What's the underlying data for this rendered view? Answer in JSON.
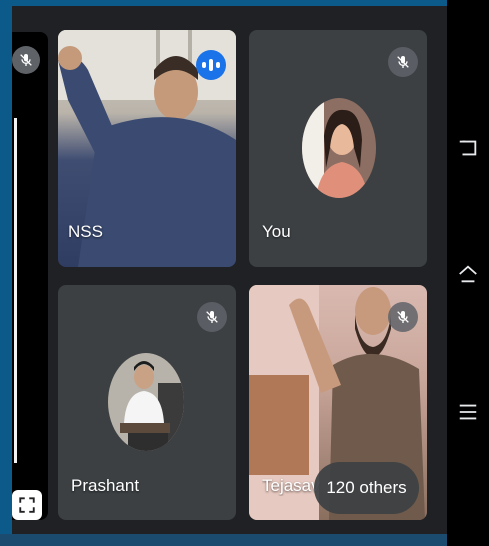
{
  "participants": [
    {
      "name": "NSS",
      "mic": "speaking"
    },
    {
      "name": "You",
      "mic": "muted"
    },
    {
      "name": "Prashant",
      "mic": "muted"
    },
    {
      "name": "Tejasav",
      "mic": "muted"
    }
  ],
  "others": {
    "label": "120 others"
  },
  "icons": {
    "mic_off": "mic-off-icon",
    "speaking": "speaking-indicator-icon",
    "expand": "expand-icon",
    "back": "back-icon",
    "home": "home-icon",
    "menu": "menu-icon"
  },
  "colors": {
    "stage": "#202124",
    "tile": "#3c4043",
    "speaking_accent": "#1a73e8",
    "badge": "#5f6368"
  }
}
